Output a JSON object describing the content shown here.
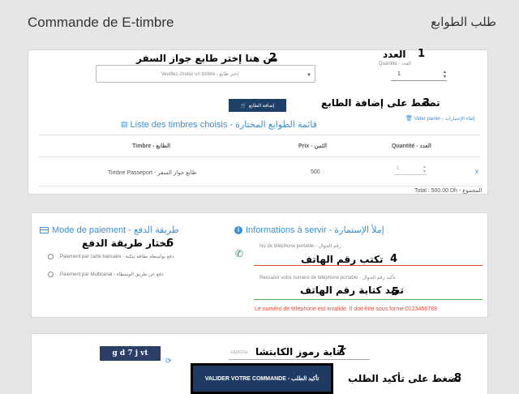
{
  "header": {
    "title_fr": "Commande de E-timbre",
    "title_ar": "طلب الطوابع"
  },
  "order": {
    "annot_1_num": "1",
    "annot_1_text": "العدد",
    "quantite_label": "Quantité - العدد",
    "quantity_value": "1",
    "annot_2_num": "2",
    "annot_2_text": "من هنا إختر طابع جواز السفر",
    "select_placeholder": "Veuillez choisir un timbre - إختر طابع",
    "add_button_label": "إضافة الطابع",
    "annot_3_num": "3",
    "annot_3_text": "تضغط على إضافة الطابع",
    "list_title": "Liste des timbres choisis - قائمة الطوابع المختارة",
    "vider_panier": "Vider panier - إلغاء الإختيارات",
    "table_headers": {
      "timbre": "Timbre - الطابع",
      "prix": "Prix - الثمن",
      "quantite": "Quantité - العدد"
    },
    "rows": [
      {
        "timbre": "Timbre Passeport - طابع جواز السفر",
        "prix": "500",
        "quantite": "1",
        "remove": "x"
      }
    ],
    "total": "Total : 500.00 Dh - المجموع"
  },
  "payment": {
    "title": "Mode de paiement - طريقة الدفع",
    "annot_6_num": "6",
    "annot_6_text": "تختار طريقة الدفع",
    "option_card": "Paiement par carte bancaire - دفع بواسطة بطاقة بنكية",
    "option_multicanal": "Paiement par Multicanal - دفع عن طريق الوسطاء"
  },
  "info": {
    "title": "Informations à servir - إملأ الإستمارة",
    "phone_label": "No de téléphone portable - رقم الجوال",
    "annot_4_num": "4",
    "annot_4_text": "تكتب رقم الهاتف",
    "phone_confirm_label": "Ressaisir votre numéro de téléphone portable - تأكيد رقم الجوال",
    "annot_5_num": "5",
    "annot_5_text": "تعيد كتابة رقم الهاتف",
    "error_text": "Le numéro de téléphone est invalide. Il doit être sous forme 0123456789"
  },
  "confirm": {
    "captcha_text": "g d 7 j vt",
    "captcha_placeholder": "captcha",
    "annot_7_num": "7",
    "annot_7_text": "كتابة رموز الكابتشا",
    "validate_label": "VALIDER VOTRE COMMANDE - تأكيد الطلب",
    "annot_8_num": "8",
    "annot_8_text": "تضغط على تأكيد الطلب"
  },
  "colors": {
    "accent": "#3b8fd3",
    "button": "#1f3b64",
    "error": "#e04a3a",
    "success": "#3fae49"
  },
  "icons": [
    "cart-icon",
    "list-icon",
    "trash-icon",
    "credit-card-icon",
    "info-icon",
    "phone-icon",
    "refresh-icon"
  ]
}
